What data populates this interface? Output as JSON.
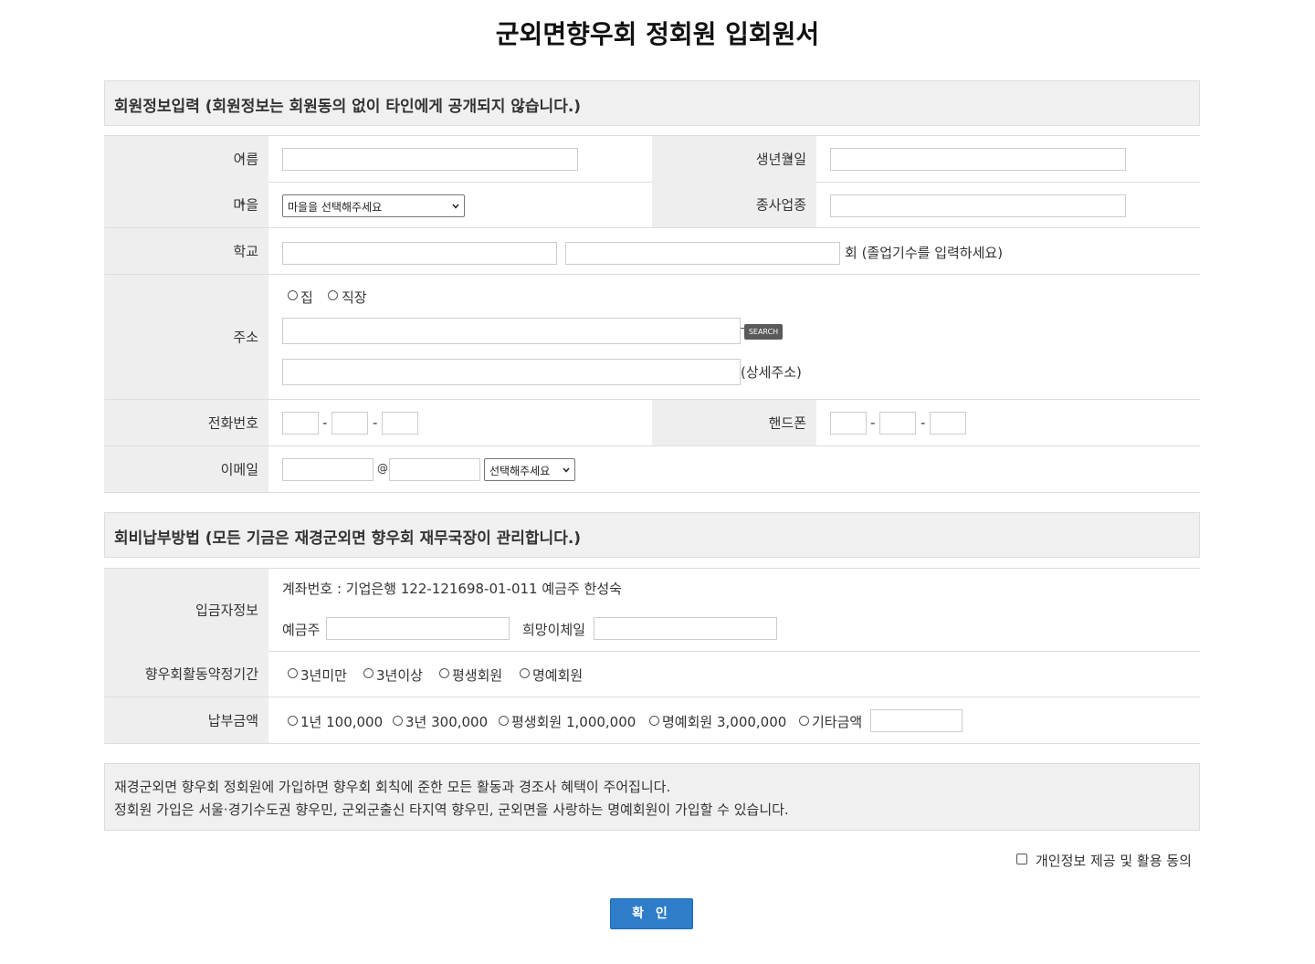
{
  "page": {
    "title": "군외면향우회 정회원 입회원서"
  },
  "sections": {
    "member_info": "회원정보입력 (회원정보는 회원동의 없이 타인에게 공개되지 않습니다.)",
    "payment": "회비납부방법 (모든 기금은 재경군외면 향우회 재무국장이 관리합니다.)"
  },
  "required_mark": "*",
  "fields": {
    "name": "이름",
    "birth": "생년월일",
    "village": "마을",
    "village_select": "마을을 선택해주세요",
    "occupation": "종사업종",
    "school": "학교",
    "school_suffix": "회 (졸업기수를 입력하세요)",
    "address": "주소",
    "addr_home": "집",
    "addr_work": "직장",
    "search": "SEARCH",
    "detail_addr": "(상세주소)",
    "phone": "전화번호",
    "mobile": "핸드폰",
    "dash": "-",
    "email": "이메일",
    "at": "@",
    "email_select": "선택해주세요"
  },
  "payment": {
    "depositor_info": "입금자정보",
    "account": "계좌번호 : 기업은행 122-121698-01-011 예금주 한성숙",
    "depositor": "예금주",
    "transfer_date": "희망이체일",
    "period_label": "향우회활동약정기간",
    "periods": [
      "3년미만",
      "3년이상",
      "평생회원",
      "명예회원"
    ],
    "amount_label": "납부금액",
    "amounts": [
      "1년 100,000",
      "3년 300,000",
      "평생회원 1,000,000",
      "명예회원 3,000,000",
      "기타금액"
    ]
  },
  "notice": [
    "재경군외면 향우회 정회원에 가입하면 향우회 회칙에 준한 모든 활동과 경조사 혜택이 주어집니다.",
    "정회원 가입은 서울·경기수도권 향우민, 군외군출신 타지역 향우민, 군외면을 사랑하는 명예회원이 가입할 수 있습니다."
  ],
  "consent": "개인정보 제공 및 활용 동의",
  "submit": "확 인"
}
